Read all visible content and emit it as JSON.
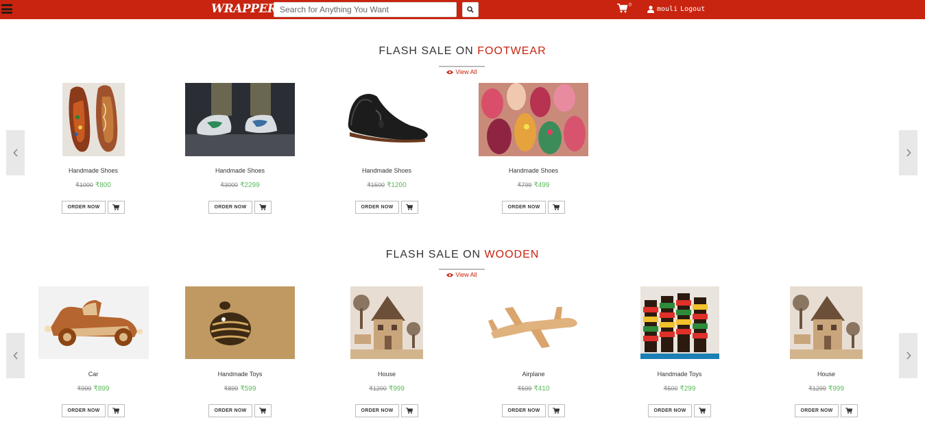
{
  "navbar": {
    "logo": "WRAPPERS",
    "search_placeholder": "Search for Anything You Want",
    "cart_count": "0",
    "username": "mouli",
    "logout": "Logout"
  },
  "footwear": {
    "title_prefix": "FLASH SALE ON ",
    "title_accent": "FOOTWEAR",
    "view_all": "View All",
    "products": [
      {
        "name": "Handmade Shoes",
        "old_price": "₹1000",
        "new_price": "₹800"
      },
      {
        "name": "Handmade Shoes",
        "old_price": "₹3000",
        "new_price": "₹2299"
      },
      {
        "name": "Handmade Shoes",
        "old_price": "₹1500",
        "new_price": "₹1200"
      },
      {
        "name": "Handmade Shoes",
        "old_price": "₹799",
        "new_price": "₹499"
      }
    ]
  },
  "wooden": {
    "title_prefix": "FLASH SALE ON ",
    "title_accent": "WOODEN",
    "view_all": "View All",
    "products": [
      {
        "name": "Car",
        "old_price": "₹999",
        "new_price": "₹899"
      },
      {
        "name": "Handmade Toys",
        "old_price": "₹899",
        "new_price": "₹599"
      },
      {
        "name": "House",
        "old_price": "₹1200",
        "new_price": "₹999"
      },
      {
        "name": "Airplane",
        "old_price": "₹599",
        "new_price": "₹410"
      },
      {
        "name": "Handmade Toys",
        "old_price": "₹500",
        "new_price": "₹299"
      },
      {
        "name": "House",
        "old_price": "₹1299",
        "new_price": "₹999"
      }
    ]
  },
  "order_now_label": "ORDER NOW"
}
